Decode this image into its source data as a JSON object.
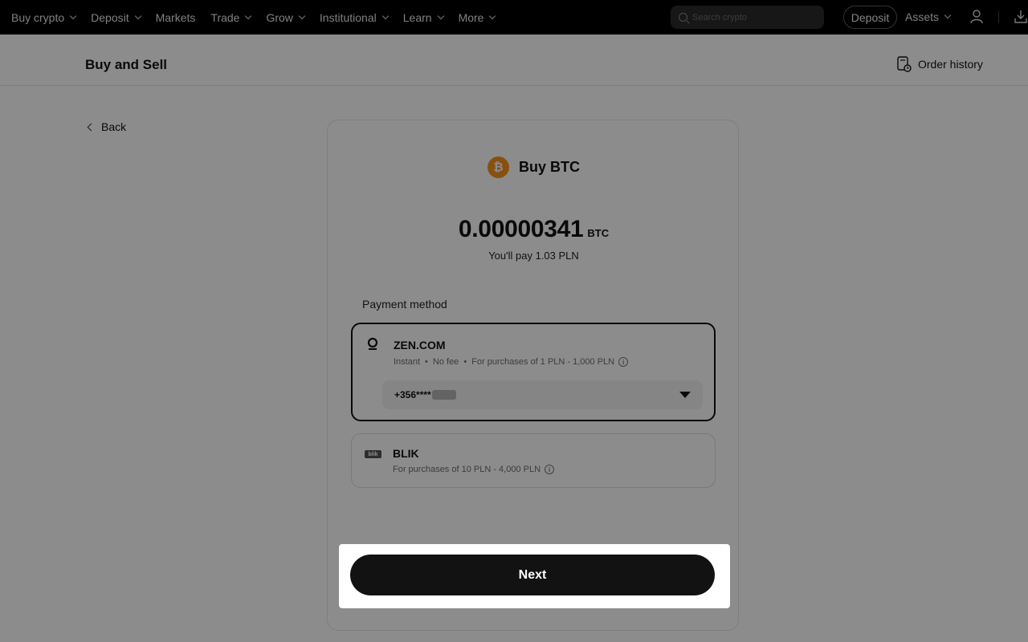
{
  "nav": {
    "items": [
      {
        "label": "Buy crypto",
        "dropdown": true
      },
      {
        "label": "Deposit",
        "dropdown": true
      },
      {
        "label": "Markets",
        "dropdown": false
      },
      {
        "label": "Trade",
        "dropdown": true
      },
      {
        "label": "Grow",
        "dropdown": true
      },
      {
        "label": "Institutional",
        "dropdown": true
      },
      {
        "label": "Learn",
        "dropdown": true
      },
      {
        "label": "More",
        "dropdown": true
      }
    ],
    "search_placeholder": "Search crypto",
    "deposit_label": "Deposit",
    "assets_label": "Assets"
  },
  "header": {
    "title": "Buy and Sell",
    "order_history": "Order history"
  },
  "back_label": "Back",
  "buy": {
    "title": "Buy BTC",
    "coin_symbol": "₿",
    "amount": "0.00000341",
    "unit": "BTC",
    "pay_line": "You'll pay 1.03 PLN"
  },
  "payment": {
    "label": "Payment method",
    "options": [
      {
        "name": "ZEN.COM",
        "tags": [
          "Instant",
          "No fee",
          "For purchases of 1 PLN - 1,000 PLN"
        ],
        "selected": true,
        "account": "+356****"
      },
      {
        "name": "BLIK",
        "logo_text": "blik",
        "tags": [
          "For purchases of 10 PLN - 4,000 PLN"
        ],
        "selected": false
      }
    ]
  },
  "next_label": "Next",
  "colors": {
    "btc": "#f7931a",
    "nav_bg": "#000000",
    "primary_button": "#121212"
  }
}
